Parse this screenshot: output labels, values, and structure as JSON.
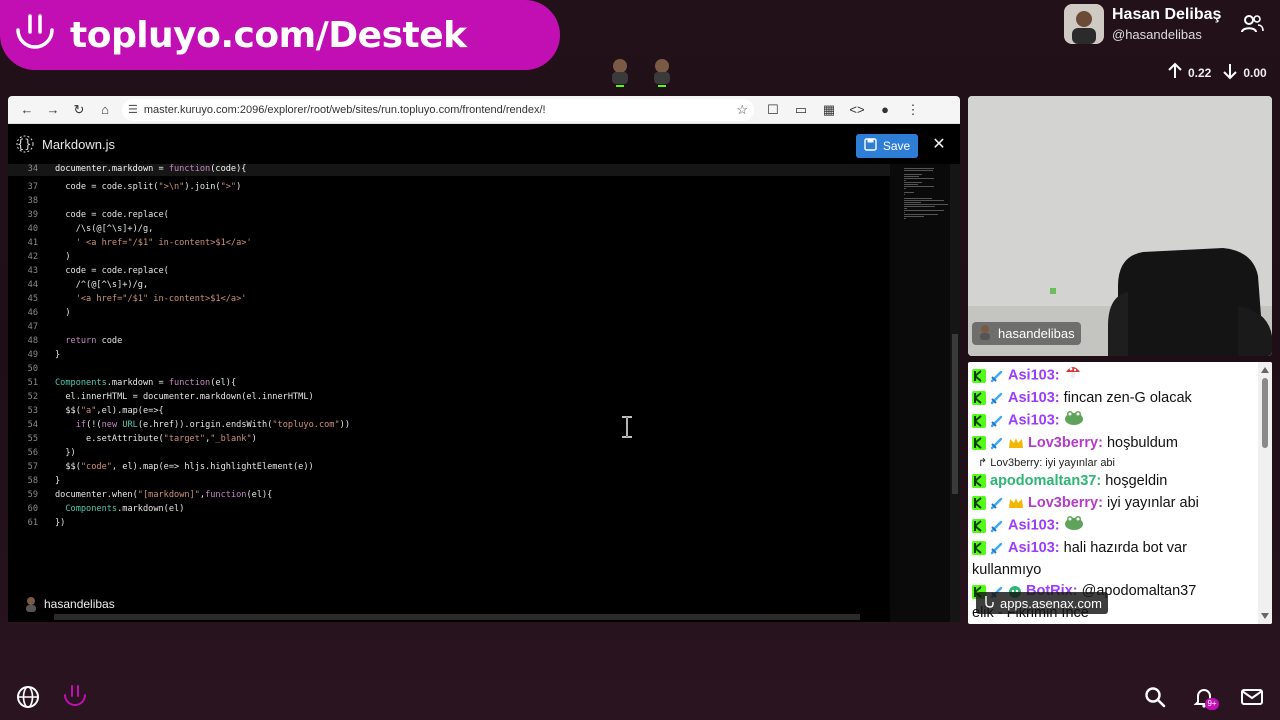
{
  "banner": {
    "title": "topluyo.com/Destek"
  },
  "profile": {
    "name": "Hasan Delibaş",
    "handle": "@hasandelibas",
    "upload": "0.22",
    "download": "0.00"
  },
  "browser": {
    "url": "master.kuruyo.com:2096/explorer/root/web/sites/run.topluyo.com/frontend/rendex/!",
    "file_name": "Markdown.js",
    "save_label": "Save",
    "streamer_tag": "hasandelibas"
  },
  "code_lines": [
    {
      "n": "34",
      "t": "documenter.markdown = function(code){"
    },
    {
      "n": "37",
      "t": "  code = code.split(\">\\n\").join(\">\")"
    },
    {
      "n": "38",
      "t": ""
    },
    {
      "n": "39",
      "t": "  code = code.replace("
    },
    {
      "n": "40",
      "t": "    /\\s(@[^\\s]+)/g,"
    },
    {
      "n": "41",
      "t": "    ' <a href=\"/$1\" in-content>$1</a>'"
    },
    {
      "n": "42",
      "t": "  )"
    },
    {
      "n": "43",
      "t": "  code = code.replace("
    },
    {
      "n": "44",
      "t": "    /^(@[^\\s]+)/g,"
    },
    {
      "n": "45",
      "t": "    '<a href=\"/$1\" in-content>$1</a>'"
    },
    {
      "n": "46",
      "t": "  )"
    },
    {
      "n": "47",
      "t": ""
    },
    {
      "n": "48",
      "t": "  return code"
    },
    {
      "n": "49",
      "t": "}"
    },
    {
      "n": "50",
      "t": ""
    },
    {
      "n": "51",
      "t": "Components.markdown = function(el){"
    },
    {
      "n": "52",
      "t": "  el.innerHTML = documenter.markdown(el.innerHTML)"
    },
    {
      "n": "53",
      "t": "  $$(\"a\",el).map(e=>{"
    },
    {
      "n": "54",
      "t": "    if(!(new URL(e.href)).origin.endsWith(\"topluyo.com\"))"
    },
    {
      "n": "55",
      "t": "      e.setAttribute(\"target\",\"_blank\")"
    },
    {
      "n": "56",
      "t": "  })"
    },
    {
      "n": "57",
      "t": "  $$(\"code\", el).map(e=> hljs.highlightElement(e))"
    },
    {
      "n": "58",
      "t": "}"
    },
    {
      "n": "59",
      "t": "documenter.when(\"[markdown]\",function(el){"
    },
    {
      "n": "60",
      "t": "  Components.markdown(el)"
    },
    {
      "n": "61",
      "t": "})"
    }
  ],
  "webcam": {
    "tag": "hasandelibas"
  },
  "chat": {
    "messages": [
      {
        "user": "Asi103:",
        "text": "",
        "color": "#9b3cff",
        "emote": "mushroom",
        "badges": [
          "kick",
          "sword"
        ]
      },
      {
        "user": "Asi103:",
        "text": "fincan zen-G olacak",
        "color": "#9b3cff",
        "badges": [
          "kick",
          "sword"
        ]
      },
      {
        "user": "Asi103:",
        "text": "",
        "color": "#9b3cff",
        "emote": "frog",
        "badges": [
          "kick",
          "sword"
        ]
      },
      {
        "user": "Lov3berry:",
        "text": "hoşbuldum",
        "color": "#b43cc8",
        "badges": [
          "kick",
          "sword",
          "crown"
        ]
      },
      {
        "reply": "↱ Lov3berry: iyi yayınlar abi"
      },
      {
        "user": "apodomaltan37:",
        "text": "hoşgeldin",
        "color": "#2bb673",
        "badges": [
          "kick"
        ]
      },
      {
        "user": "Lov3berry:",
        "text": "iyi yayınlar abi",
        "color": "#b43cc8",
        "badges": [
          "kick",
          "sword",
          "crown"
        ]
      },
      {
        "user": "Asi103:",
        "text": "",
        "color": "#9b3cff",
        "emote": "frog",
        "badges": [
          "kick",
          "sword"
        ]
      },
      {
        "user": "Asi103:",
        "text": "hali hazırda bot var",
        "color": "#9b3cff",
        "badges": [
          "kick",
          "sword"
        ]
      },
      {
        "plain": "kullanmıyo"
      },
      {
        "user": "BotRix:",
        "text": "@apodomaltan37",
        "color": "#9b3cff",
        "badges": [
          "kick",
          "sword",
          "bot"
        ]
      },
      {
        "plain": "                    elik - Fikrimin İnce"
      }
    ],
    "overlay_pill": "apps.asenax.com"
  },
  "notifications": {
    "badge": "9+"
  },
  "colors": {
    "brand": "#c20fb4",
    "save_button": "#2e7ed6",
    "kick_green": "#53fc18"
  }
}
